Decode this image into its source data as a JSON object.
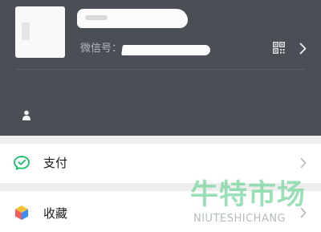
{
  "profile": {
    "wechat_id_label": "微信号：",
    "qrcode_icon": "qrcode-icon",
    "chevron_icon": "chevron-right-icon",
    "status_icon": "person-icon"
  },
  "menu": {
    "items": [
      {
        "label": "支付",
        "icon": "wechat-pay-icon",
        "chevron": "chevron-right-icon"
      },
      {
        "label": "收藏",
        "icon": "favorites-cube-icon",
        "chevron": "chevron-right-icon"
      }
    ]
  },
  "watermark": {
    "title": "牛特市场",
    "subtitle": "NIUTESHICHANG"
  },
  "colors": {
    "header_bg": "#4a4e55",
    "page_bg": "#ededed",
    "pay_green": "#07c160",
    "watermark_green": "#7ed8a2"
  }
}
